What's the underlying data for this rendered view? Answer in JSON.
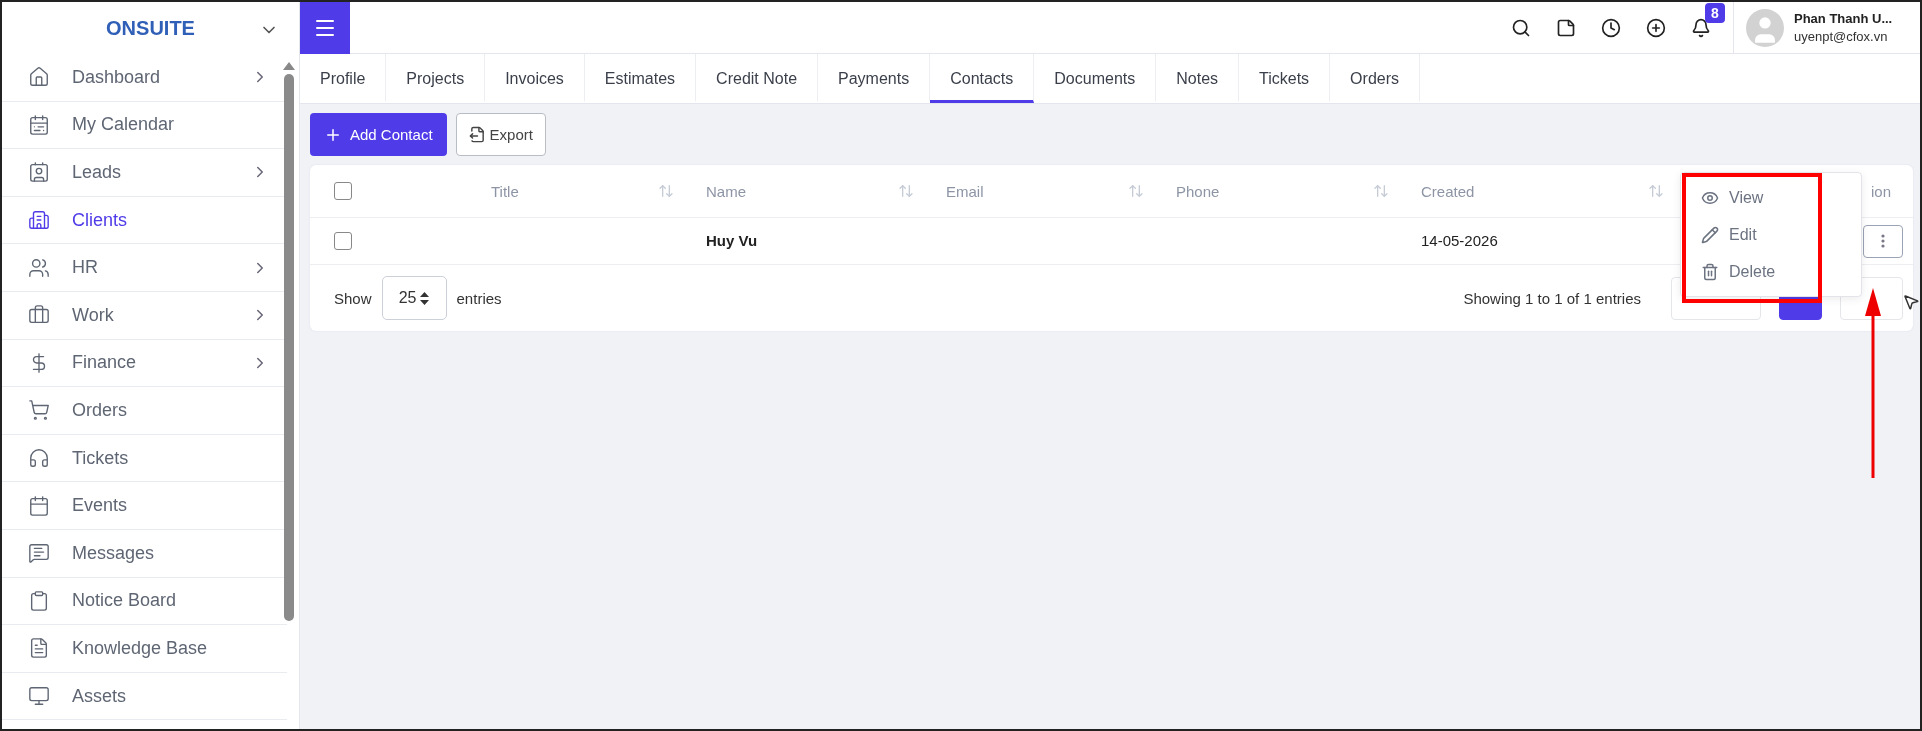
{
  "sidebar": {
    "brand": "ONSUITE",
    "items": [
      {
        "label": "Dashboard",
        "selected": false,
        "expandable": true
      },
      {
        "label": "My Calendar",
        "selected": false,
        "expandable": false
      },
      {
        "label": "Leads",
        "selected": false,
        "expandable": true
      },
      {
        "label": "Clients",
        "selected": true,
        "expandable": false
      },
      {
        "label": "HR",
        "selected": false,
        "expandable": true
      },
      {
        "label": "Work",
        "selected": false,
        "expandable": true
      },
      {
        "label": "Finance",
        "selected": false,
        "expandable": true
      },
      {
        "label": "Orders",
        "selected": false,
        "expandable": false
      },
      {
        "label": "Tickets",
        "selected": false,
        "expandable": false
      },
      {
        "label": "Events",
        "selected": false,
        "expandable": false
      },
      {
        "label": "Messages",
        "selected": false,
        "expandable": false
      },
      {
        "label": "Notice Board",
        "selected": false,
        "expandable": false
      },
      {
        "label": "Knowledge Base",
        "selected": false,
        "expandable": false
      },
      {
        "label": "Assets",
        "selected": false,
        "expandable": false
      }
    ]
  },
  "header": {
    "notification_count": "8",
    "user": {
      "name": "Phan Thanh U...",
      "email": "uyenpt@cfox.vn"
    }
  },
  "tabs": [
    {
      "label": "Profile",
      "selected": false
    },
    {
      "label": "Projects",
      "selected": false
    },
    {
      "label": "Invoices",
      "selected": false
    },
    {
      "label": "Estimates",
      "selected": false
    },
    {
      "label": "Credit Note",
      "selected": false
    },
    {
      "label": "Payments",
      "selected": false
    },
    {
      "label": "Contacts",
      "selected": true
    },
    {
      "label": "Documents",
      "selected": false
    },
    {
      "label": "Notes",
      "selected": false
    },
    {
      "label": "Tickets",
      "selected": false
    },
    {
      "label": "Orders",
      "selected": false
    }
  ],
  "toolbar": {
    "add_button": "Add Contact",
    "export_button": "Export"
  },
  "table": {
    "select_all_checked": false,
    "columns": [
      "Title",
      "Name",
      "Email",
      "Phone",
      "Created",
      "ion"
    ],
    "rows": [
      {
        "checked": false,
        "cells": [
          "",
          "Huy Vu",
          "",
          "",
          "14-05-2026"
        ]
      }
    ],
    "show_label": "Show",
    "page_size": "25",
    "entries_label": "entries",
    "summary": "Showing 1 to 1 of 1 entries",
    "pagination": [
      {
        "selected": false
      },
      {
        "selected": true
      },
      {
        "selected": false
      }
    ]
  },
  "action_menu": {
    "items": [
      "View",
      "Edit",
      "Delete"
    ]
  }
}
